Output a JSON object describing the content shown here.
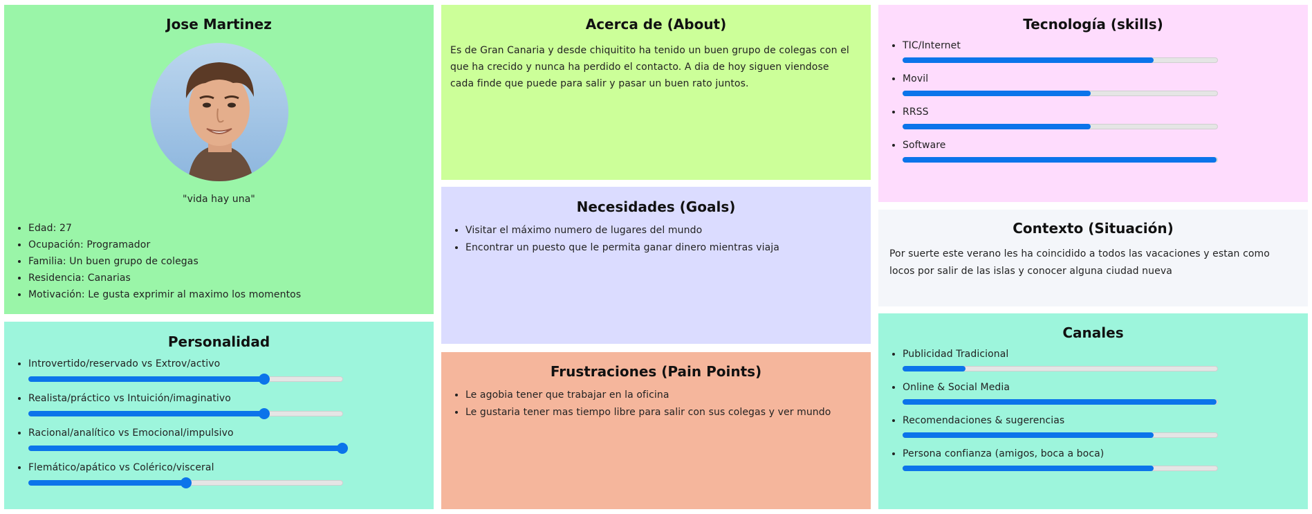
{
  "profile": {
    "name": "Jose Martinez",
    "quote": "\"vida hay una\"",
    "details": [
      "Edad: 27",
      "Ocupación: Programador",
      "Familia: Un buen grupo de colegas",
      "Residencia: Canarias",
      "Motivación: Le gusta exprimir al maximo los momentos"
    ]
  },
  "personality": {
    "title": "Personalidad",
    "traits": [
      {
        "label": "Introvertido/reservado vs Extrov/activo",
        "value": 0.75
      },
      {
        "label": "Realista/práctico vs Intuición/imaginativo",
        "value": 0.75
      },
      {
        "label": "Racional/analítico vs Emocional/impulsivo",
        "value": 1.0
      },
      {
        "label": "Flemático/apático vs Colérico/visceral",
        "value": 0.5
      }
    ]
  },
  "about": {
    "title": "Acerca de (About)",
    "text": "Es de Gran Canaria y desde chiquitito ha tenido un buen grupo de colegas con el que ha crecido y nunca ha perdido el contacto. A dia de hoy siguen viendose cada finde que puede para salir y pasar un buen rato juntos."
  },
  "goals": {
    "title": "Necesidades (Goals)",
    "items": [
      "Visitar el máximo numero de lugares del mundo",
      "Encontrar un puesto que le permita ganar dinero mientras viaja"
    ]
  },
  "pains": {
    "title": "Frustraciones (Pain Points)",
    "items": [
      "Le agobia tener que trabajar en la oficina",
      "Le gustaria tener mas tiempo libre para salir con sus colegas y ver mundo"
    ]
  },
  "skills": {
    "title": "Tecnología (skills)",
    "items": [
      {
        "label": "TIC/Internet",
        "value": 0.8
      },
      {
        "label": "Movil",
        "value": 0.6
      },
      {
        "label": "RRSS",
        "value": 0.6
      },
      {
        "label": "Software",
        "value": 1.0
      }
    ]
  },
  "context": {
    "title": "Contexto (Situación)",
    "text": "Por suerte este verano les ha coincidido a todos las vacaciones y estan como locos por salir de las islas y conocer alguna ciudad nueva"
  },
  "channels": {
    "title": "Canales",
    "items": [
      {
        "label": "Publicidad Tradicional",
        "value": 0.2
      },
      {
        "label": "Online & Social Media",
        "value": 1.0
      },
      {
        "label": "Recomendaciones & sugerencias",
        "value": 0.8
      },
      {
        "label": "Persona confianza (amigos, boca a boca)",
        "value": 0.8
      }
    ]
  },
  "colors": {
    "profile_bg": "#9af5a8",
    "personality_bg": "#9df5dc",
    "about_bg": "#ccff99",
    "goals_bg": "#dbdcff",
    "pains_bg": "#f5b69c",
    "skills_bg": "#fedcfd",
    "context_bg": "#f4f6fa",
    "channels_bg": "#9df5dc",
    "accent": "#0b74ea"
  }
}
